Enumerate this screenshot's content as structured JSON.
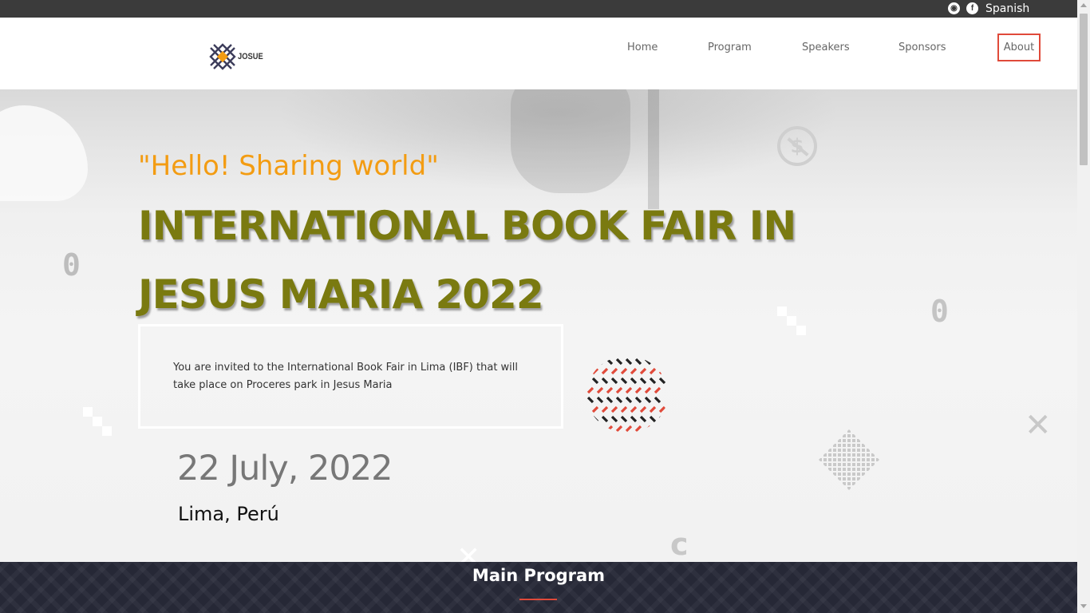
{
  "topbar": {
    "github_icon": "github-icon",
    "facebook_icon": "facebook-icon",
    "language": "Spanish"
  },
  "header": {
    "logo_text": "JOSUE",
    "nav": {
      "home": "Home",
      "program": "Program",
      "speakers": "Speakers",
      "sponsors": "Sponsors",
      "about": "About"
    }
  },
  "hero": {
    "tagline": "\"Hello! Sharing world\"",
    "title": "INTERNATIONAL BOOK FAIR IN JESUS MARIA 2022",
    "invite": "You are invited to the International Book Fair in Lima (IBF) that will take place on Proceres park in Jesus Maria",
    "date": "22 July, 2022",
    "place": "Lima, Perú"
  },
  "program": {
    "title": "Main Program"
  },
  "colors": {
    "accent_orange": "#f39c12",
    "title_olive": "#7a7a10",
    "nav_active_border": "#e04a3a",
    "band_dark": "#262836"
  }
}
